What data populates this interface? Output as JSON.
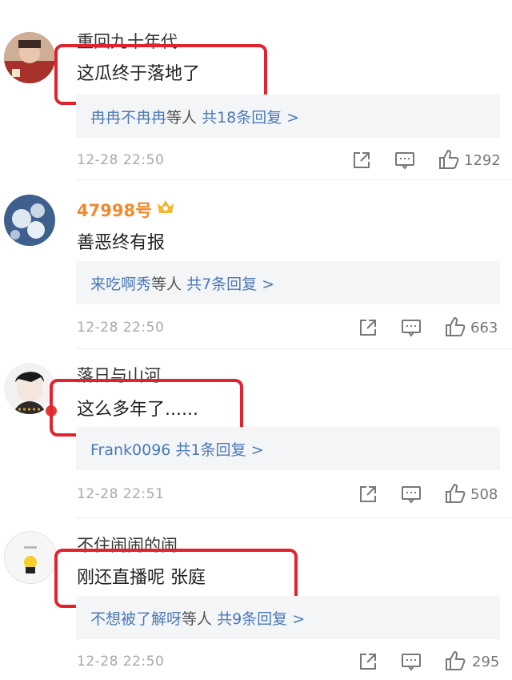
{
  "comments": [
    {
      "username": "重回九十年代",
      "text": "这瓜终于落地了",
      "reply_users": "冉冉不冉冉",
      "reply_mid": "等人",
      "reply_count": "共18条回复 >",
      "time": "12-28 22:50",
      "likes": "1292"
    },
    {
      "username": "47998号",
      "text": "善恶终有报",
      "reply_users": "来吃啊秀",
      "reply_mid": "等人",
      "reply_count": "共7条回复 >",
      "time": "12-28 22:50",
      "likes": "663"
    },
    {
      "username": "落日与山河",
      "text": "这么多年了......",
      "reply_users": "Frank0096",
      "reply_mid": "",
      "reply_count": "共1条回复 >",
      "time": "12-28 22:51",
      "likes": "508"
    },
    {
      "username": "不住闹闹的闹",
      "text": "刚还直播呢 张庭",
      "reply_users": "不想被了解呀",
      "reply_mid": "等人",
      "reply_count": "共9条回复 >",
      "time": "12-28 22:50",
      "likes": "295"
    }
  ],
  "colors": {
    "highlight_border": "#e0232e",
    "link": "#4a79b8",
    "vip_name": "#f08a2c"
  },
  "icons": [
    "share-icon",
    "comment-icon",
    "like-icon",
    "vip-badge-icon"
  ]
}
